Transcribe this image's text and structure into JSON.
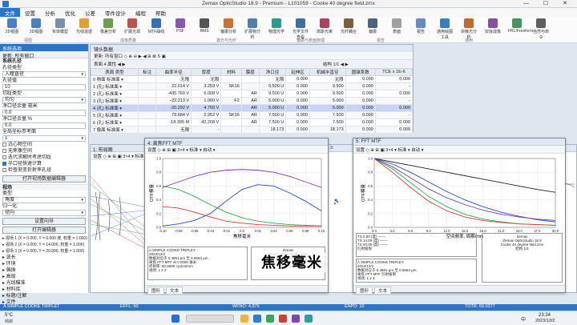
{
  "window": {
    "title": "Zemax OpticStudio 18.9 - Premium - L101059 - Cooke 40 degree field.zmx",
    "controls": "— ☐ ✕"
  },
  "menu": [
    "文件",
    "设置",
    "分析",
    "优化",
    "公差",
    "零件设计",
    "编程",
    "帮助"
  ],
  "ribbon": {
    "buttons": [
      {
        "label": "2D视图",
        "color": "#4a7fc1"
      },
      {
        "label": "3D视图",
        "color": "#4a7fc1"
      },
      {
        "label": "实体模型",
        "color": "#7a8fa8"
      },
      {
        "label": "光线追迹",
        "color": "#e0a030"
      },
      {
        "label": "像差分析",
        "color": "#6b9e4e"
      },
      {
        "label": "扩展光源",
        "color": "#c25050"
      },
      {
        "label": "MTF曲线",
        "color": "#3a6db5"
      },
      {
        "label": "PSF",
        "color": "#8a56b0"
      },
      {
        "label": "RMS",
        "color": "#555"
      },
      {
        "label": "偏振分析",
        "color": "#d07030"
      },
      {
        "label": "扩展物分析",
        "color": "#5080b0"
      },
      {
        "label": "物理光学",
        "color": "#2a9a8a"
      },
      {
        "label": "光学文件查看",
        "color": "#4070a0"
      },
      {
        "label": "高斯光束",
        "color": "#b04060"
      },
      {
        "label": "光纤耦合",
        "color": "#7a6040"
      },
      {
        "label": "偏振",
        "color": "#506080"
      },
      {
        "label": "表面",
        "color": "#a0a0a0"
      },
      {
        "label": "报告",
        "color": "#6a8ac0"
      },
      {
        "label": "通用绘图工具",
        "color": "#3a80c0"
      },
      {
        "label": "杂散光分析",
        "color": "#c06a30"
      },
      {
        "label": "双目成像",
        "color": "#8a50a0"
      },
      {
        "label": "FRL/Freeform",
        "color": "#4a9060"
      },
      {
        "label": "自然与命令",
        "color": "#606060"
      }
    ],
    "groups": [
      "视图",
      "成像质量",
      "激光与光纤",
      "偏振与表面物理",
      "报告",
      "通用"
    ]
  },
  "left_panel": {
    "title": "系统选项",
    "sub": "更新: 所有窗口",
    "section_aperture": "系统孔径",
    "aperture_type_label": "孔径类型",
    "aperture_type_value": "入瞳直径",
    "aperture_value_label": "孔径值",
    "aperture_value": "10",
    "apodization_label": "切趾类型",
    "apodization_value": "均匀",
    "nr_label": "净口径余量 毫米",
    "nr_value": "0.0",
    "nr2_label": "净口径余量 %",
    "nr2_value": "0.0",
    "global_ref_label": "全局坐标参考面",
    "global_ref_value": "1",
    "checks": [
      {
        "label": "远心物空间",
        "on": false
      },
      {
        "label": "无焦像空间",
        "on": false
      },
      {
        "label": "迭代求解时考虑切趾",
        "on": false
      },
      {
        "label": "半口径快速计算",
        "on": true
      },
      {
        "label": "检查渐变折射率孔径",
        "on": false
      }
    ],
    "btn_convert": "打开视场数据编辑器",
    "section_field": "视场",
    "field_type_label": "类型:",
    "field_type_value": "角度",
    "normalization_label": "归一化:",
    "normalization_value": "径向",
    "btn_settings": "设置向导",
    "btn_open": "打开编辑器",
    "fields": [
      "视场 1 (X = 0.000, Y = 0.000 度, 权重 = 1.000)",
      "视场 2 (X = 0.000, Y = 14.000, 权重 = 1.000)",
      "视场 3 (X = 0.000, Y = 20.000, 权重 = 1.000)"
    ],
    "sections": [
      "波长",
      "环境",
      "偏振",
      "高级",
      "光线瞄准",
      "材料库",
      "标题/注解",
      "文件"
    ]
  },
  "lde": {
    "tab": "镜头数据",
    "toolbar": "更新: 所有窗口  ◇  ⊕ ⊖  ▶ ◀  ⊞  ⊠  S  ▣",
    "surfbar": "表面  4 属性  ◀  ▶",
    "config": "结构 1/1  ◀  ▶",
    "columns": [
      "表面 类型",
      "标注",
      "曲率半径",
      "厚度",
      "材料",
      "膜层",
      "净口径",
      "延伸区",
      "机械半直径",
      "圆锥系数",
      "TCE x 1E-6"
    ],
    "rows": [
      [
        "0 物面 标准面 ▾",
        "",
        "无限",
        "无限",
        "",
        "",
        "无限",
        "0.000",
        "无限",
        "0.000",
        "0.000"
      ],
      [
        "1 (孔) 标准面 ▾",
        "",
        "22.014 V",
        "3.259 V",
        "SK16",
        "",
        "9.500 U",
        "0.000",
        "9.500",
        "0.000",
        "-"
      ],
      [
        "2 (孔) 标准面 ▾",
        "",
        "-435.760 V",
        "6.008 V",
        "",
        "AR",
        "9.500 U",
        "0.000",
        "9.500",
        "0.000",
        "0.000"
      ],
      [
        "3 (孔) 标准面 ▾",
        "",
        "-22.213 V",
        "1.000 V",
        "F2",
        "AR",
        "5.000 U",
        "0.000",
        "5.000",
        "0.000",
        "-"
      ],
      [
        "4 (孔) 标准面 ▾",
        "",
        "-20.292 V",
        "4.750 V",
        "",
        "AR",
        "5.000 U",
        "0.000",
        "5.000",
        "0.000",
        "0.000"
      ],
      [
        "5 (孔) 标准面 ▾",
        "",
        "79.684 V",
        "2.952 V",
        "SK16",
        "AR",
        "7.500 U",
        "0.000",
        "7.500",
        "0.000",
        "-"
      ],
      [
        "6 (孔) 标准面 ▾",
        "",
        "-18.395 M",
        "42.208 V",
        "",
        "AR",
        "7.500 U",
        "0.000",
        "7.500",
        "0.000",
        "0.000"
      ],
      [
        "7 像面 标准面 ▾",
        "",
        "无限",
        "-",
        "",
        "",
        "18.173",
        "0.000",
        "18.173",
        "0.000",
        "0.000"
      ]
    ]
  },
  "layout_win": {
    "tab": "1: 布局图",
    "toolbar": "设置  ◇ ⊕ ⊞ ▣  3×4 ▾  标准 ▾"
  },
  "focus_win": {
    "tab": "4: 离焦FFT MTF",
    "toolbar": "设置  ◇ ⊕ ⊞ ▣  3×4 ▾  标准 ▾  自动 ▾",
    "info": [
      "A SIMPLE COOKE TRIPLET.",
      "2023/12/2",
      "数据对应于 0.4861 μm 至 0.6563 μm.",
      "离焦 FFT MTF at 0.0000 毫米",
      "折射率: 50.0000 cycles/mm",
      "视场: 1 2 3"
    ],
    "zemax": [
      "Zemax",
      "Zemax OpticStudio 18.9",
      "",
      "Cooke 40 degree field.zmx",
      "结构 1/1"
    ],
    "tabs": [
      "图形",
      "文本"
    ]
  },
  "fft_win": {
    "tab": "5: FFT MTF",
    "toolbar": "设置  ◇ ⊕ ⊞ ▣  3×4 ▾  标准 ▾  自动 ▾",
    "legend": [
      "TS 0.00 (度)   ——",
      "TS 14.00 (度)  ——",
      "TS 20.00 (度)  ——",
      "衍射极限"
    ],
    "info": [
      "A SIMPLE COOKE TRIPLET.",
      "2023/12/2",
      "数据对应于 0.4861 μm 至 0.6563 μm.",
      "离焦 FFT MTF 衍射极限",
      "视场: 1 2 3"
    ],
    "zemax": [
      "Zemax",
      "Zemax OpticStudio 18.9",
      "",
      "Cooke 40 degree field.zmx",
      "结构 1/1"
    ],
    "tabs": [
      "图形",
      "文本"
    ]
  },
  "subtitle": "焦移毫米",
  "statusbar": {
    "left": "A SIMPLE COOKE TRIPLET",
    "efl": "EFFL: 50",
    "wfno": "WFNO: 4.879",
    "enpd": "ENPD: 10",
    "totr": "TOTR: 60.0377"
  },
  "taskbar": {
    "weather": "5°C",
    "weather2": "晴朗",
    "time": "23:34",
    "date": "2023/12/2",
    "lang": "中"
  },
  "chart_data": [
    {
      "type": "line",
      "title": "离焦FFT MTF",
      "xlabel": "焦移毫米",
      "ylabel": "OTF模量",
      "x": [
        -0.1,
        -0.08,
        -0.06,
        -0.04,
        -0.02,
        0.0,
        0.02,
        0.04,
        0.06,
        0.08,
        0.1
      ],
      "xlim": [
        -0.1,
        0.1
      ],
      "ylim": [
        0.0,
        1.0
      ],
      "series": [
        {
          "name": "TS 0.00 (度)",
          "color": "#1f50b5",
          "values": [
            0.02,
            0.05,
            0.1,
            0.2,
            0.38,
            0.55,
            0.62,
            0.6,
            0.5,
            0.38,
            0.24
          ]
        },
        {
          "name": "TS 14.00 (度)",
          "color": "#2fa84a",
          "values": [
            0.6,
            0.55,
            0.45,
            0.33,
            0.22,
            0.14,
            0.09,
            0.06,
            0.04,
            0.03,
            0.02
          ]
        },
        {
          "name": "TS 20.00 (度)",
          "color": "#d23c3c",
          "values": [
            0.3,
            0.28,
            0.22,
            0.15,
            0.09,
            0.06,
            0.04,
            0.03,
            0.02,
            0.02,
            0.02
          ]
        },
        {
          "name": "衍射极限",
          "color": "#7a3aa0",
          "values": [
            0.58,
            0.66,
            0.74,
            0.8,
            0.83,
            0.84,
            0.83,
            0.8,
            0.74,
            0.66,
            0.58
          ]
        }
      ]
    },
    {
      "type": "line",
      "title": "FFT MTF",
      "xlabel": "空间频率, 周期/mm",
      "ylabel": "OTF模量",
      "x": [
        0,
        3,
        6,
        9,
        12,
        15,
        18,
        21,
        24,
        27,
        30
      ],
      "xlim": [
        0,
        30
      ],
      "ylim": [
        0.0,
        1.0
      ],
      "series": [
        {
          "name": "衍射极限",
          "color": "#222222",
          "values": [
            1.0,
            0.95,
            0.9,
            0.85,
            0.8,
            0.75,
            0.7,
            0.65,
            0.6,
            0.55,
            0.51
          ]
        },
        {
          "name": "TS 0.00 (度)",
          "color": "#1f50b5",
          "values": [
            1.0,
            0.92,
            0.8,
            0.66,
            0.52,
            0.4,
            0.3,
            0.22,
            0.16,
            0.11,
            0.08
          ]
        },
        {
          "name": "TS 14.00 (度)",
          "color": "#2fa84a",
          "values": [
            1.0,
            0.85,
            0.65,
            0.45,
            0.3,
            0.19,
            0.12,
            0.08,
            0.05,
            0.04,
            0.03
          ]
        },
        {
          "name": "TS 20.00 (度)",
          "color": "#d23c3c",
          "values": [
            1.0,
            0.8,
            0.58,
            0.38,
            0.24,
            0.15,
            0.1,
            0.07,
            0.05,
            0.04,
            0.03
          ]
        },
        {
          "name": "T 20.00 (度)",
          "color": "#7a3aa0",
          "values": [
            1.0,
            0.88,
            0.72,
            0.56,
            0.43,
            0.33,
            0.25,
            0.19,
            0.15,
            0.12,
            0.1
          ]
        }
      ]
    }
  ]
}
